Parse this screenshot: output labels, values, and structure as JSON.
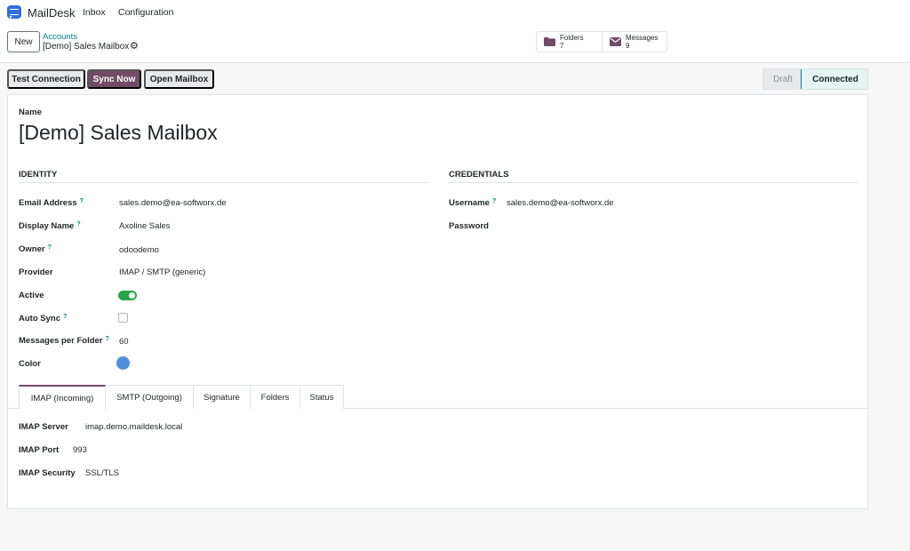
{
  "navbar": {
    "app_name": "MailDesk",
    "menu": [
      "Inbox",
      "Configuration"
    ]
  },
  "control_panel": {
    "new_label": "New",
    "breadcrumb_parent": "Accounts",
    "breadcrumb_current": "[Demo] Sales Mailbox",
    "smart_buttons": [
      {
        "label": "Folders",
        "count": "7",
        "icon": "folder-icon"
      },
      {
        "label": "Messages",
        "count": "9",
        "icon": "envelope-icon"
      }
    ]
  },
  "actions": {
    "test_connection": "Test Connection",
    "sync_now": "Sync Now",
    "open_mailbox": "Open Mailbox"
  },
  "statusbar": {
    "states": [
      "Draft",
      "Connected"
    ],
    "current": "Connected"
  },
  "form": {
    "name_label": "Name",
    "name_value": "[Demo] Sales Mailbox",
    "identity_title": "IDENTITY",
    "credentials_title": "CREDENTIALS",
    "identity": [
      {
        "label": "Email Address",
        "help": "?",
        "value": "sales.demo@ea-softworx.de"
      },
      {
        "label": "Display Name",
        "help": "?",
        "value": "Axoline Sales"
      },
      {
        "label": "Owner",
        "help": "?",
        "value": "odoodemo"
      },
      {
        "label": "Provider",
        "help": "",
        "value": "IMAP / SMTP (generic)"
      },
      {
        "label": "Active",
        "help": "",
        "value": ""
      },
      {
        "label": "Auto Sync",
        "help": "?",
        "value": ""
      },
      {
        "label": "Messages per Folder",
        "help": "?",
        "value": "60"
      },
      {
        "label": "Color",
        "help": "",
        "value": ""
      }
    ],
    "credentials": [
      {
        "label": "Username",
        "help": "?",
        "value": "sales.demo@ea-softworx.de"
      },
      {
        "label": "Password",
        "help": "",
        "value": ""
      }
    ],
    "active": true,
    "auto_sync": false,
    "color": "#4f8fdb"
  },
  "tabs": {
    "items": [
      "IMAP (Incoming)",
      "SMTP (Outgoing)",
      "Signature",
      "Folders",
      "Status"
    ],
    "active": "IMAP (Incoming)",
    "imap": [
      {
        "label": "IMAP Server",
        "value": "imap.demo.maildesk.local"
      },
      {
        "label": "IMAP Port",
        "value": "993"
      },
      {
        "label": "IMAP Security",
        "value": "SSL/TLS"
      }
    ]
  },
  "colors": {
    "primary": "#714b67",
    "accent": "#017e84",
    "toggle_on": "#28a745",
    "logo": "#2f6fdb"
  }
}
